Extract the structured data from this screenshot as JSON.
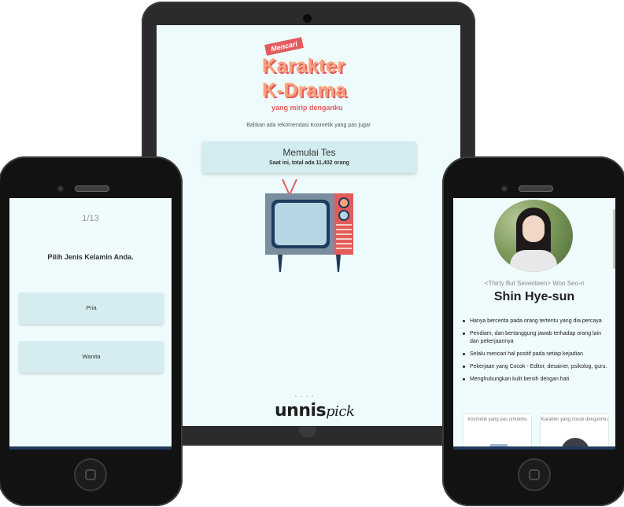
{
  "tablet": {
    "tag": "Mencari",
    "title_line1": "Karakter",
    "title_line2": "K-Drama",
    "subtitle": "yang mirip denganku",
    "tagline": "Bahkan ada rekomendasi Kosmetik yang pas juga!",
    "start_button": {
      "title": "Memulai Tes",
      "subtitle": "Saat ini, total ada 11,402 orang"
    },
    "brand_name": "unnis",
    "brand_script": "pick",
    "brand_dots": "• • • •"
  },
  "phone_left": {
    "counter": "1/13",
    "question": "Pilih Jenis Kelamin Anda.",
    "options": [
      "Pria",
      "Wanita"
    ]
  },
  "phone_right": {
    "show": "<Thirty But Seventeen> Woo Seo-ri",
    "name": "Shin Hye-sun",
    "traits": [
      "Hanya bercerita pada orang tertentu yang dia percaya",
      "Pendiam, dan bertanggung jawab terhadap orang lain dan pekerjaannya",
      "Selalu mencari hal positif pada setiap kejadian",
      "Pekerjaan yang Cocok - Editor, desainer, psikolog, guru.",
      "Menghubungkan kulit bersih dengan hati"
    ],
    "cards": [
      "Kosmetik yang pas untukmu",
      "Karakter yang cocok denganmu"
    ]
  },
  "colors": {
    "accent": "#e35c5c",
    "logo_fill": "#f7a27f",
    "screen_bg": "#eefbfd",
    "button_bg": "#d3ecef",
    "device_body": "#2b2b2d"
  }
}
